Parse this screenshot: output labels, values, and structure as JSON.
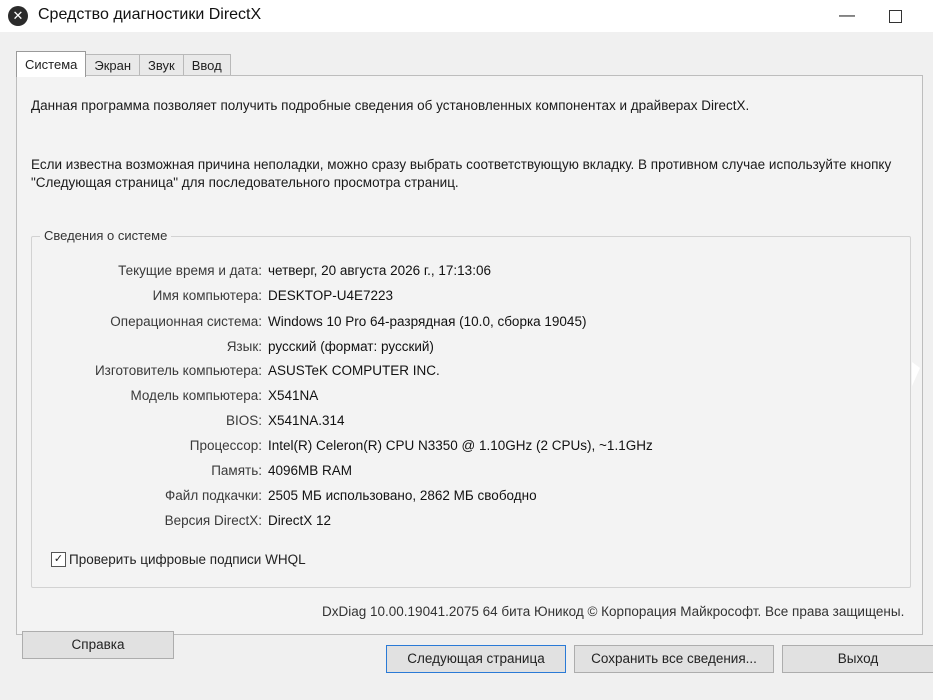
{
  "window": {
    "title": "Средство диагностики DirectX",
    "minimize_glyph": "—",
    "app_icon_glyph": "✕"
  },
  "tabs": [
    {
      "label": "Система",
      "active": true
    },
    {
      "label": "Экран",
      "active": false
    },
    {
      "label": "Звук",
      "active": false
    },
    {
      "label": "Ввод",
      "active": false
    }
  ],
  "intro": {
    "line1": "Данная программа позволяет получить подробные сведения об установленных компонентах и драйверах DirectX.",
    "line2": "Если известна возможная причина неполадки, можно сразу выбрать соответствующую вкладку. В противном случае используйте кнопку \"Следующая страница\" для последовательного просмотра страниц."
  },
  "system_info": {
    "group_title": "Сведения о системе",
    "rows": [
      {
        "label": "Текущие время и дата:",
        "value": "четверг, 20 августа 2026 г., 17:13:06"
      },
      {
        "label": "Имя компьютера:",
        "value": "DESKTOP-U4E7223"
      },
      {
        "label": "Операционная система:",
        "value": "Windows 10 Pro 64-разрядная (10.0, сборка 19045)"
      },
      {
        "label": "Язык:",
        "value": "русский (формат: русский)"
      },
      {
        "label": "Изготовитель компьютера:",
        "value": "ASUSTeK COMPUTER INC."
      },
      {
        "label": "Модель компьютера:",
        "value": "X541NA"
      },
      {
        "label": "BIOS:",
        "value": "X541NA.314"
      },
      {
        "label": "Процессор:",
        "value": "Intel(R) Celeron(R) CPU N3350 @ 1.10GHz (2 CPUs), ~1.1GHz"
      },
      {
        "label": "Память:",
        "value": "4096MB RAM"
      },
      {
        "label": "Файл подкачки:",
        "value": "2505 МБ использовано, 2862 МБ свободно"
      },
      {
        "label": "Версия DirectX:",
        "value": "DirectX 12"
      }
    ]
  },
  "whql": {
    "label": "Проверить цифровые подписи WHQL",
    "checked": true,
    "check_glyph": "✓"
  },
  "footer": {
    "copyright": "DxDiag 10.00.19041.2075 64 бита Юникод © Корпорация Майкрософт. Все права защищены."
  },
  "buttons": {
    "help": "Справка",
    "next_page": "Следующая страница",
    "save_all": "Сохранить все сведения...",
    "exit": "Выход"
  }
}
